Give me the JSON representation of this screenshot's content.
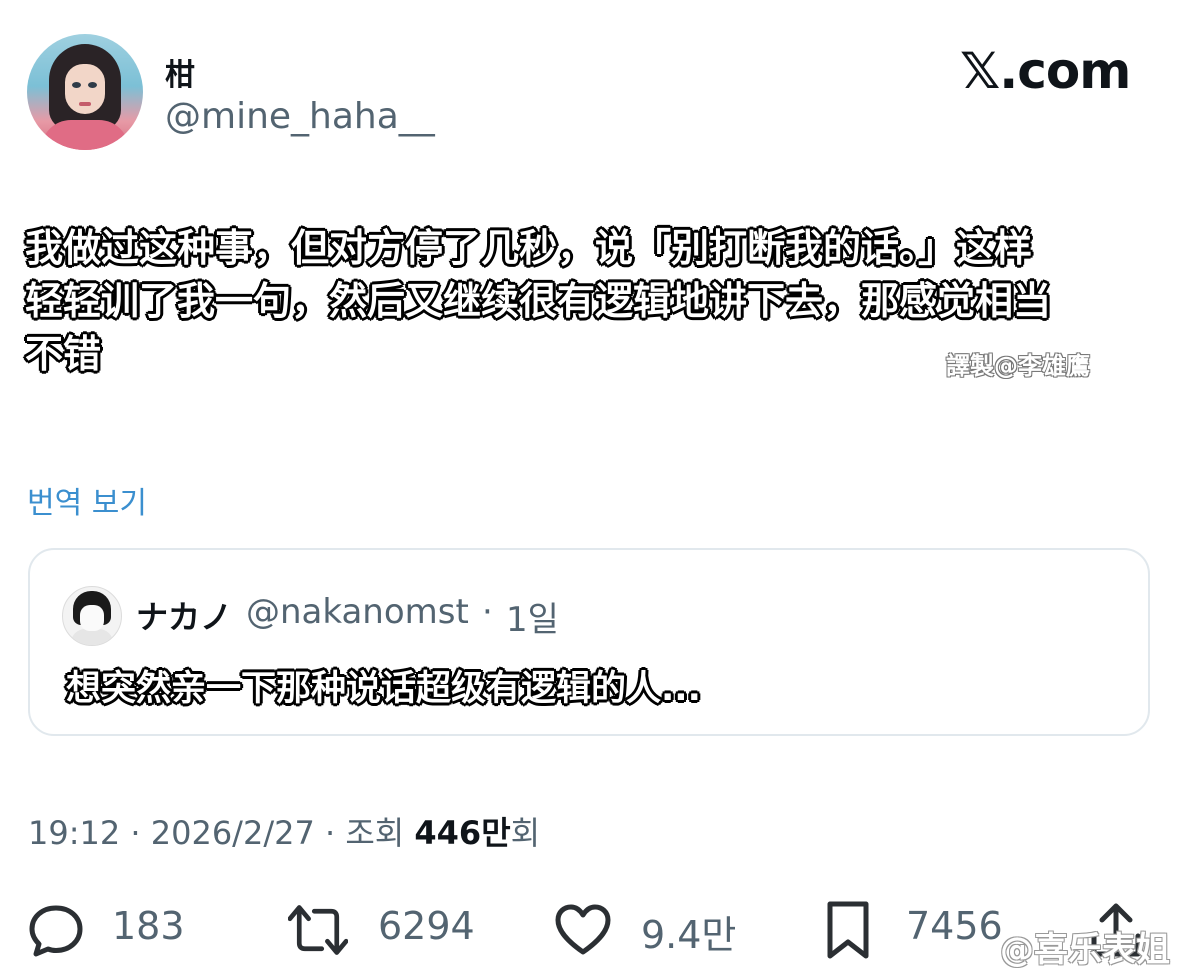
{
  "author": {
    "display_name": "柑",
    "handle": "@mine_haha__"
  },
  "brand": "𝕏.com",
  "tweet": {
    "text_lines": [
      "我做过这种事，但对方停了几秒，说「别打断我的话。」这样",
      "轻轻训了我一句，然后又继续很有逻辑地讲下去，那感觉相当",
      "不错"
    ],
    "translator_credit": "譯製@李雄鷹",
    "translate_link": "번역 보기"
  },
  "quote": {
    "name": "ナカノ",
    "handle": "@nakanomst",
    "separator": "·",
    "time": "1일",
    "text": "想突然亲一下那种说话超级有逻辑的人..."
  },
  "meta": {
    "time": "19:12",
    "date": "2026/2/27",
    "sep": " · ",
    "views_label": "조회",
    "views_value": "446만",
    "views_suffix": "회"
  },
  "actions": {
    "replies": "183",
    "retweets": "6294",
    "likes": "9.4만",
    "bookmarks": "7456"
  },
  "watermark": "@喜乐表姐",
  "colors": {
    "text_primary": "#0f1419",
    "text_secondary": "#536471",
    "link": "#3b8fcf",
    "card_border": "#e1e8ed"
  }
}
